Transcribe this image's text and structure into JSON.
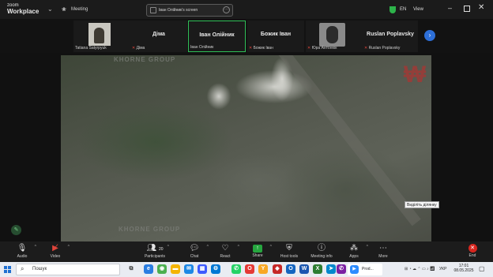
{
  "titlebar": {
    "app_name_line1": "zoom",
    "app_name_line2": "Workplace",
    "meeting_label": "Meeting",
    "screen_share_label": "Іван Олійник's screen",
    "language": "EN",
    "view_label": "View"
  },
  "participants": [
    {
      "name": "",
      "sub": "Tatiana Satyrpyuk",
      "muted": false,
      "video": true
    },
    {
      "name": "Діма",
      "sub": "Діма",
      "muted": true,
      "video": false
    },
    {
      "name": "Іван Олійник",
      "sub": "Іван Олійник",
      "muted": false,
      "video": false,
      "active_speaker": true
    },
    {
      "name": "Божик Іван",
      "sub": "Божик Іван",
      "muted": true,
      "video": false
    },
    {
      "name": "",
      "sub": "Юра Антонюк",
      "muted": true,
      "video": true
    },
    {
      "name": "Ruslan Poplavsky",
      "sub": "Ruslan Poplavsky",
      "muted": true,
      "video": false
    }
  ],
  "shared_screen": {
    "watermark": "KHORNE GROUP",
    "logo_glyph": "₩",
    "tooltip": "Виділіть ділянку"
  },
  "toolbar": {
    "audio": "Audio",
    "video": "Video",
    "participants": "Participants",
    "participants_count": "20",
    "chat": "Chat",
    "react": "React",
    "share": "Share",
    "host_tools": "Host tools",
    "meeting_info": "Meeting info",
    "apps": "Apps",
    "more": "More",
    "end": "End"
  },
  "taskbar": {
    "search_placeholder": "Пошук",
    "active_app_label": "Prod...",
    "language": "УКР",
    "time": "17:01",
    "date": "08.05.2025"
  },
  "colors": {
    "active_speaker_border": "#2fbf57",
    "share_green": "#26a63f",
    "end_red": "#d7261f",
    "muted_red": "#e0453b",
    "next_blue": "#2d6fd8"
  }
}
